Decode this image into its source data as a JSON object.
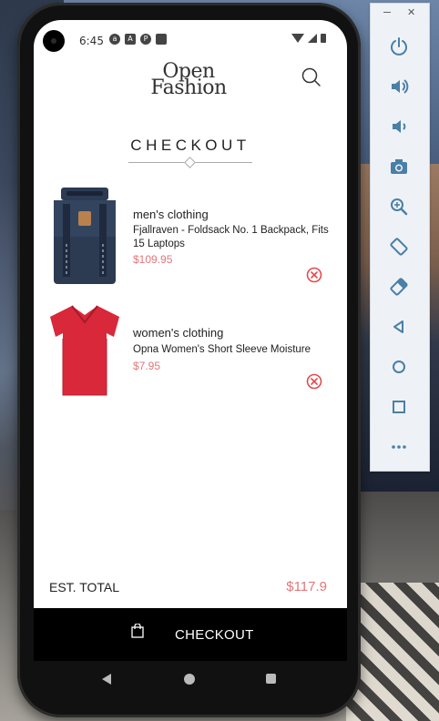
{
  "app": {
    "logo_line1": "Open",
    "logo_line2": "Fashion",
    "page_title": "CHECKOUT"
  },
  "status_bar": {
    "time": "6:45",
    "notification_icons": [
      "a",
      "A",
      "P",
      ""
    ]
  },
  "cart_items": [
    {
      "category": "men's clothing",
      "name": "Fjallraven - Foldsack No. 1 Backpack, Fits 15 Laptops",
      "price": "$109.95",
      "image_icon": "backpack-image"
    },
    {
      "category": "women's clothing",
      "name": "Opna Women's Short Sleeve Moisture",
      "price": "$7.95",
      "image_icon": "tshirt-image"
    }
  ],
  "summary": {
    "total_label": "EST. TOTAL",
    "total_value": "$117.9"
  },
  "checkout_button": {
    "label": "CHECKOUT",
    "icon": "shopping-bag-icon"
  },
  "colors": {
    "accent": "#e4767a",
    "bar": "#000000",
    "text": "#222222"
  },
  "emulator_panel": {
    "buttons": [
      "power-icon",
      "volume-up-icon",
      "volume-down-icon",
      "camera-icon",
      "zoom-icon",
      "rotate-left-icon",
      "rotate-right-icon",
      "back-icon",
      "home-icon",
      "overview-icon",
      "more-icon"
    ]
  }
}
